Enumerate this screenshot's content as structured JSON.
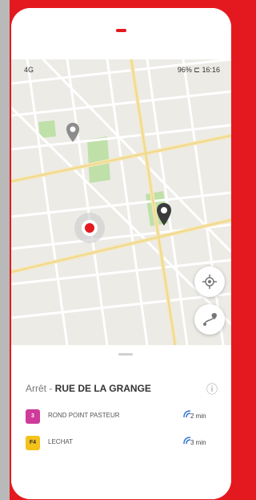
{
  "status_bar": {
    "signal": "4G",
    "battery_time": "96% ⊏ 16:16"
  },
  "stop": {
    "prefix": "Arrêt - ",
    "name": "RUE DE LA GRANGE"
  },
  "lines": [
    {
      "code": "3",
      "destination": "ROND POINT PASTEUR",
      "time": "2 min",
      "color": "#cf3a9b",
      "text_color": "#ffffff"
    },
    {
      "code": "F4",
      "destination": "LECHAT",
      "time": "3 min",
      "color": "#f3c21b",
      "text_color": "#333333"
    }
  ],
  "icons": {
    "locate": "crosshair-icon",
    "route": "route-icon",
    "info": "info-icon",
    "realtime": "realtime-icon"
  },
  "colors": {
    "brand": "#e3191f",
    "map_bg": "#ecebe6",
    "park": "#bfe0a8"
  }
}
